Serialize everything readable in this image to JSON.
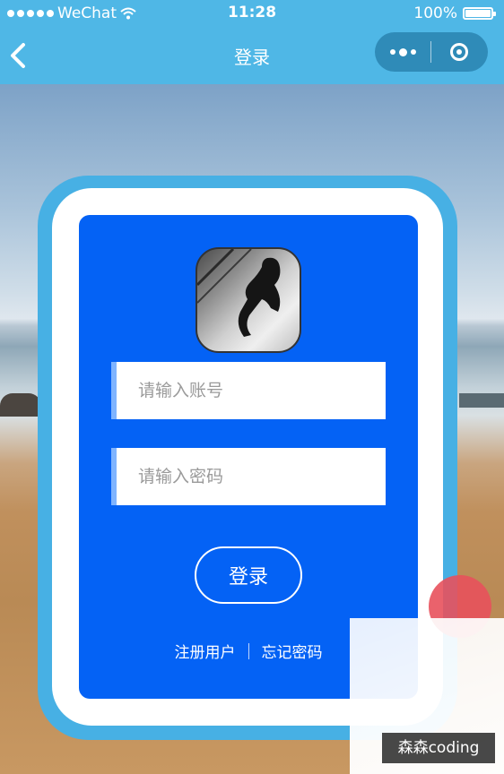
{
  "status_bar": {
    "carrier": "WeChat",
    "time": "11:28",
    "battery": "100%"
  },
  "nav": {
    "title": "登录"
  },
  "login": {
    "account_placeholder": "请输入账号",
    "password_placeholder": "请输入密码",
    "login_button": "登录",
    "register_link": "注册用户",
    "forgot_link": "忘记密码"
  },
  "watermark": "森森coding",
  "colors": {
    "nav_bar": "#4fb7e6",
    "panel": "#0462f5",
    "card_border": "#47b0e4",
    "fab": "#e8515c"
  }
}
